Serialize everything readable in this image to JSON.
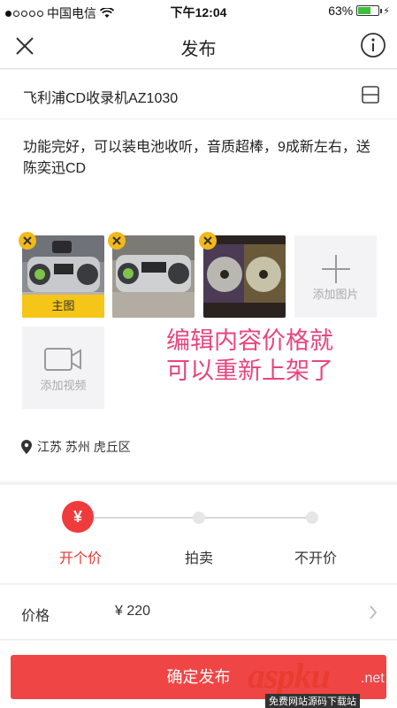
{
  "status_bar": {
    "carrier": "中国电信",
    "time": "下午12:04",
    "battery": "63%",
    "battery_level": 0.63
  },
  "nav": {
    "title": "发布"
  },
  "listing": {
    "title": "飞利浦CD收录机AZ1030",
    "description": "功能完好，可以装电池收听，音质超棒，9成新左右，送陈奕迅CD",
    "cover_label": "主图",
    "add_photo_label": "添加图片",
    "add_video_label": "添加视频",
    "location": "江苏 苏州 虎丘区"
  },
  "annotation": {
    "line1": "编辑内容价格就",
    "line2": "可以重新上架了"
  },
  "pricing": {
    "options": [
      "开个价",
      "拍卖",
      "不开价"
    ],
    "selected_symbol": "¥",
    "price_label": "价格",
    "price_value": "¥ 220"
  },
  "actions": {
    "submit_label": "确定发布"
  },
  "watermark": {
    "brand": "aspku",
    "domain": ".net",
    "tagline": "免费网站源码下载站"
  }
}
